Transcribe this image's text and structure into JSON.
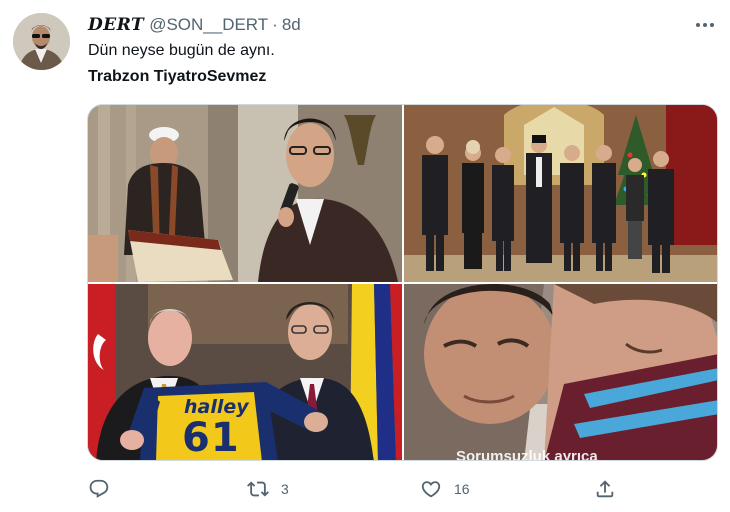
{
  "tweet": {
    "display_name": "DERT",
    "handle": "@SON__DERT",
    "separator": "·",
    "time": "8d",
    "text_line1": "Dün neyse bugün de aynı.",
    "text_line2": "Trabzon TiyatroSevmez"
  },
  "media": {
    "photos": [
      {
        "name": "photo-1"
      },
      {
        "name": "photo-2"
      },
      {
        "name": "photo-3",
        "jersey_brand": "halley",
        "jersey_number": "61"
      },
      {
        "name": "photo-4",
        "caption": "Sorumsuzluk ayrıca"
      }
    ]
  },
  "actions": {
    "reply_icon": "reply-icon",
    "retweet_icon": "retweet-icon",
    "retweet_count": "3",
    "like_icon": "like-icon",
    "like_count": "16",
    "share_icon": "share-icon"
  },
  "colors": {
    "text_primary": "#0f1419",
    "text_secondary": "#536471",
    "border": "#cfd9de"
  }
}
